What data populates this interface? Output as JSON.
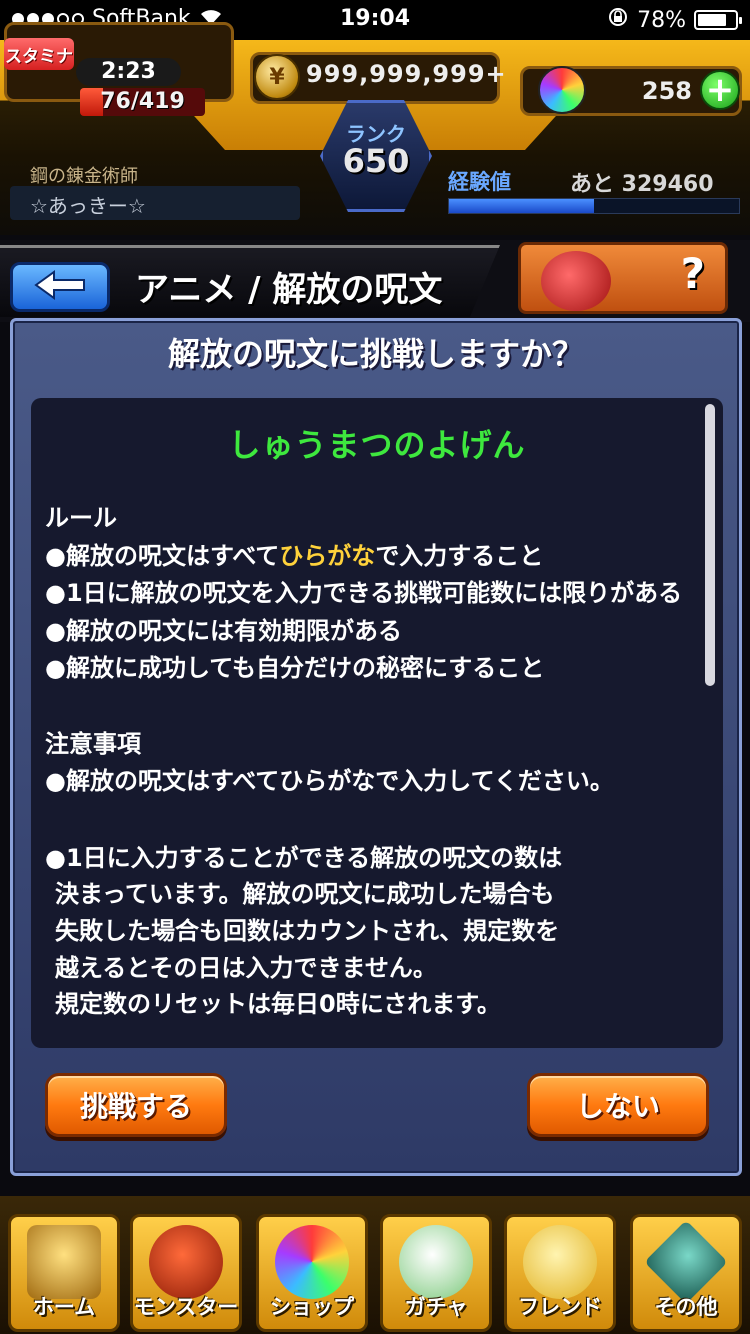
{
  "status_bar": {
    "carrier": "SoftBank",
    "time": "19:04",
    "battery": "78%",
    "battery_level": 0.78
  },
  "hud": {
    "stamina_label": "スタミナ",
    "stamina_timer": "2:23",
    "stamina": "76/419",
    "stamina_fraction": 0.18,
    "coins": "999,999,999+",
    "orbs": "258",
    "rank_label": "ランク",
    "rank": "650",
    "player_title": "鋼の錬金術師",
    "player_name": "☆あっきー☆",
    "exp_label": "経験値",
    "exp_remaining": "あと 329460",
    "exp_fraction": 0.5
  },
  "header": {
    "title": "アニメ / 解放の呪文"
  },
  "dialog": {
    "title": "解放の呪文に挑戦しますか？",
    "keyword": "しゅうまつのよげん",
    "rules_heading": "ルール",
    "rule1_pre": "●解放の呪文はすべて",
    "rule1_hl": "ひらがな",
    "rule1_post": "で入力すること",
    "rule2": "●1日に解放の呪文を入力できる挑戦可能数には限りがある",
    "rule3": "●解放の呪文には有効期限がある",
    "rule4": "●解放に成功しても自分だけの秘密にすること",
    "notes_heading": "注意事項",
    "note1": "●解放の呪文はすべてひらがなで入力してください。",
    "note2_line1": "●1日に入力することができる解放の呪文の数は",
    "note2_line2": "決まっています。解放の呪文に成功した場合も",
    "note2_line3": "失敗した場合も回数はカウントされ、規定数を",
    "note2_line4": "越えるとその日は入力できません。",
    "note2_line5": "規定数のリセットは毎日0時にされます。",
    "btn_challenge": "挑戦する",
    "btn_no": "しない"
  },
  "nav": {
    "home": "ホーム",
    "monster": "モンスター",
    "shop": "ショップ",
    "gacha": "ガチャ",
    "friend": "フレンド",
    "other": "その他"
  }
}
